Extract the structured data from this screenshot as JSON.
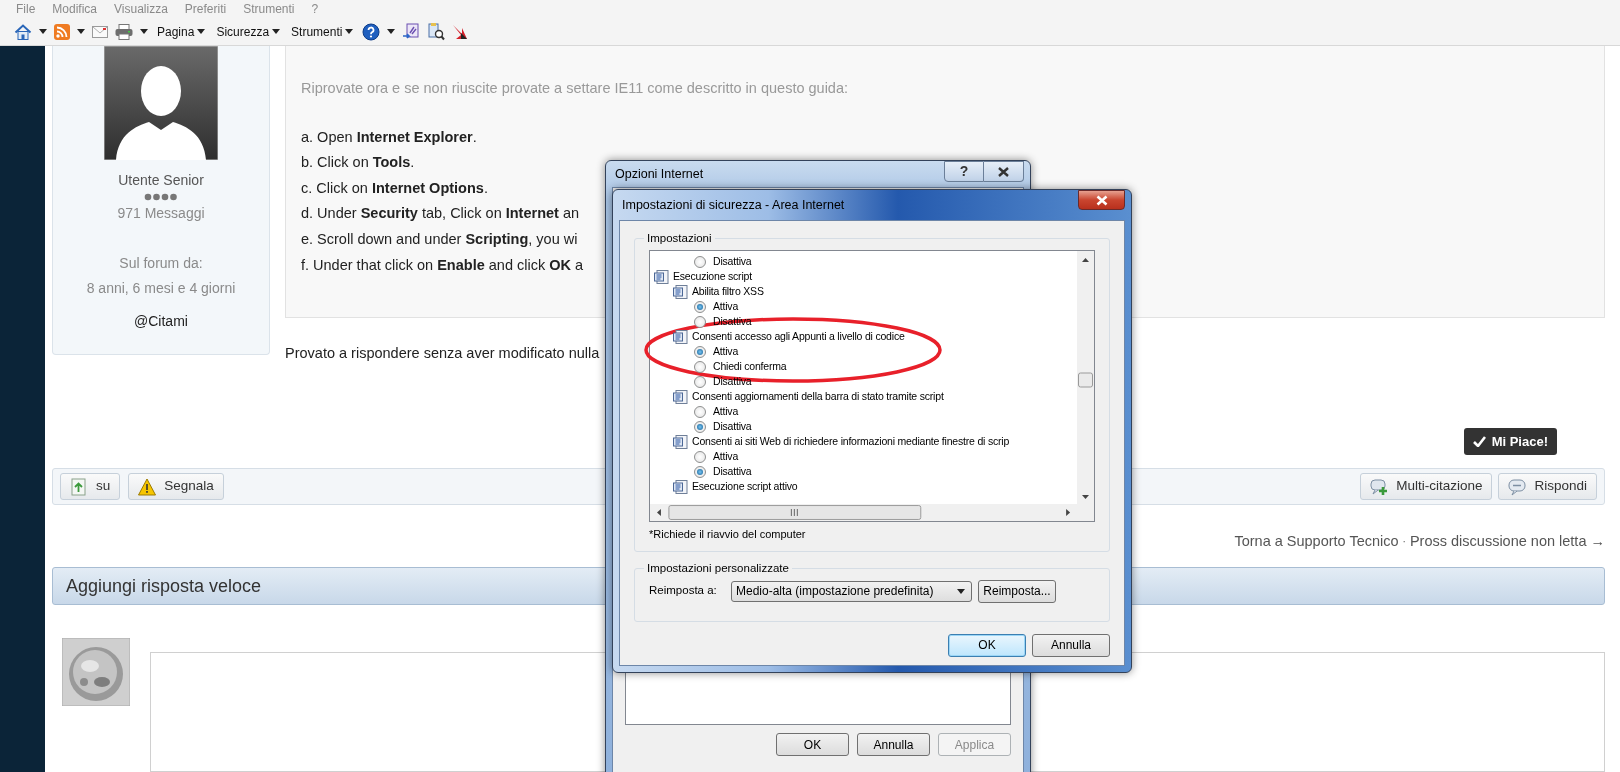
{
  "menu_bar": [
    "File",
    "Modifica",
    "Visualizza",
    "Preferiti",
    "Strumenti",
    "?"
  ],
  "command_bar": {
    "menus": [
      "Pagina",
      "Sicurezza",
      "Strumenti"
    ]
  },
  "profile": {
    "rank": "Utente Senior",
    "posts": "971 Messaggi",
    "member_since_label": "Sul forum da:",
    "member_since": "8 anni, 6 mesi e 4 giorni",
    "mention": "@Citami"
  },
  "post": {
    "intro": "Riprovate ora e se non riuscite provate a settare IE11 come descritto in questo guida:",
    "steps": [
      "a. Open **Internet Explorer**.",
      "b. Click on **Tools**.",
      "c. Click on **Internet Options**.",
      "d. Under **Security** tab, Click on **Internet** an",
      "e. Scroll down and under **Scripting**, you wi",
      "f. Under that click on **Enable** and click **OK** a"
    ],
    "reply": "Provato a rispondere senza aver modificato nulla"
  },
  "like_button": "Mi Piace!",
  "post_actions_left": [
    {
      "label": "su",
      "kind": "top"
    },
    {
      "label": "Segnala",
      "kind": "report"
    }
  ],
  "post_actions_right": [
    {
      "label": "Multi-citazione",
      "kind": "multiquote"
    },
    {
      "label": "Rispondi",
      "kind": "reply"
    }
  ],
  "navigation": {
    "back": "Torna a Supporto Tecnico",
    "separator": "·",
    "next": "Pross discussione non letta →"
  },
  "quick_reply": {
    "title": "Aggiungi risposta veloce"
  },
  "internet_options_dialog": {
    "title": "Opzioni Internet",
    "help_button": "?",
    "buttons": [
      {
        "label": "OK",
        "disabled": false
      },
      {
        "label": "Annulla",
        "disabled": false
      },
      {
        "label": "Applica",
        "disabled": true
      }
    ]
  },
  "security_dialog": {
    "title": "Impostazioni di sicurezza - Area Internet",
    "settings_group": "Impostazioni",
    "settings": [
      {
        "kind": "option",
        "label": "Disattiva",
        "selected": false
      },
      {
        "kind": "group",
        "label": "Esecuzione script",
        "children": [
          {
            "kind": "setting",
            "label": "Abilita filtro XSS",
            "children": [
              {
                "kind": "option",
                "label": "Attiva",
                "selected": true
              },
              {
                "kind": "option",
                "label": "Disattiva",
                "selected": false
              }
            ]
          },
          {
            "kind": "setting",
            "label": "Consenti accesso agli Appunti a livello di codice",
            "children": [
              {
                "kind": "option",
                "label": "Attiva",
                "selected": true
              },
              {
                "kind": "option",
                "label": "Chiedi conferma",
                "selected": false
              },
              {
                "kind": "option",
                "label": "Disattiva",
                "selected": false
              }
            ]
          },
          {
            "kind": "setting",
            "label": "Consenti aggiornamenti della barra di stato tramite script",
            "children": [
              {
                "kind": "option",
                "label": "Attiva",
                "selected": false
              },
              {
                "kind": "option",
                "label": "Disattiva",
                "selected": true
              }
            ]
          },
          {
            "kind": "setting",
            "label": "Consenti ai siti Web di richiedere informazioni mediante finestre di scrip",
            "children": [
              {
                "kind": "option",
                "label": "Attiva",
                "selected": false
              },
              {
                "kind": "option",
                "label": "Disattiva",
                "selected": true
              }
            ]
          },
          {
            "kind": "setting",
            "label": "Esecuzione script attivo"
          }
        ]
      }
    ],
    "note": "*Richiede il riavvio del computer",
    "custom_group": "Impostazioni personalizzate",
    "reset_label": "Reimposta a:",
    "reset_level": "Medio-alta (impostazione predefinita)",
    "reset_button": "Reimposta...",
    "buttons": [
      {
        "label": "OK",
        "default": true
      },
      {
        "label": "Annulla",
        "default": false
      }
    ]
  }
}
